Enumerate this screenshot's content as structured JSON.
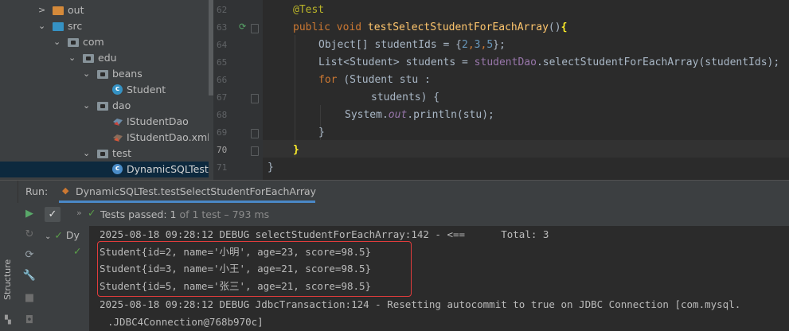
{
  "project_tree": {
    "items": [
      {
        "label": "out",
        "icon": "folder-icon",
        "color": "#d58a3a",
        "arrow": ">",
        "indent": 1
      },
      {
        "label": "src",
        "icon": "folder-icon",
        "color": "#3592c4",
        "arrow": "v",
        "indent": 1
      },
      {
        "label": "com",
        "icon": "package-icon",
        "arrow": "v",
        "indent": 2
      },
      {
        "label": "edu",
        "icon": "package-icon",
        "arrow": "v",
        "indent": 3
      },
      {
        "label": "beans",
        "icon": "package-icon",
        "arrow": "v",
        "indent": 4
      },
      {
        "label": "Student",
        "icon": "class-icon",
        "indent": 5
      },
      {
        "label": "dao",
        "icon": "package-icon",
        "arrow": "v",
        "indent": 4
      },
      {
        "label": "IStudentDao",
        "icon": "mybatis-icon",
        "indent": 5
      },
      {
        "label": "IStudentDao.xml",
        "icon": "mybatis-xml-icon",
        "indent": 5
      },
      {
        "label": "test",
        "icon": "package-icon",
        "arrow": "v",
        "indent": 4
      },
      {
        "label": "DynamicSQLTest",
        "icon": "test-class-icon",
        "indent": 5,
        "selected": true
      }
    ]
  },
  "editor": {
    "line_numbers": [
      "62",
      "63",
      "64",
      "65",
      "66",
      "67",
      "68",
      "69",
      "70",
      "71"
    ],
    "current_line": "70",
    "code": {
      "l62_annotation": "@Test",
      "l63_kw": "public void ",
      "l63_fn": "testSelectStudentForEachArray",
      "l63_paren": "()",
      "l63_brace": "{",
      "l64_a": "Object[] studentIds = {",
      "l64_n1": "2",
      "l64_c1": ",",
      "l64_n2": "3",
      "l64_c2": ",",
      "l64_n3": "5",
      "l64_b": "};",
      "l65_a": "List<Student> students = ",
      "l65_fld": "studentDao",
      "l65_b": ".selectStudentForEachArray(studentIds);",
      "l66_kw": "for ",
      "l66_b": "(Student stu :",
      "l67": "students) {",
      "l68_a": "System.",
      "l68_out": "out",
      "l68_b": ".println(stu);",
      "l69": "}",
      "l70": "}",
      "l71": "}"
    }
  },
  "run_panel": {
    "run_label": "Run:",
    "tab_label": "DynamicSQLTest.testSelectStudentForEachArray",
    "tab_close": "×",
    "side_label": "Structure",
    "status": {
      "passed_prefix": "Tests passed: ",
      "passed_count": "1",
      "passed_rest": " of 1 test – 793 ms"
    },
    "test_tree": {
      "root_label": "Dy"
    },
    "console_lines": [
      "2025-08-18 09:28:12 DEBUG selectStudentForEachArray:142 - <==      Total: 3",
      "Student{id=2, name='小明', age=23, score=98.5}",
      "Student{id=3, name='小王', age=21, score=98.5}",
      "Student{id=5, name='张三', age=21, score=98.5}",
      "2025-08-18 09:28:12 DEBUG JdbcTransaction:124 - Resetting autocommit to true on JDBC Connection [com.mysql.",
      ".JDBC4Connection@768b970c]"
    ]
  },
  "colors": {
    "background": "#2b2b2b",
    "panel": "#3c3f41",
    "keyword": "#cc7832",
    "annotation": "#bbb529",
    "function": "#ffc66d",
    "number": "#6897bb",
    "field": "#9876aa",
    "pass_green": "#5ba049",
    "highlight_border": "#e03c3c"
  }
}
